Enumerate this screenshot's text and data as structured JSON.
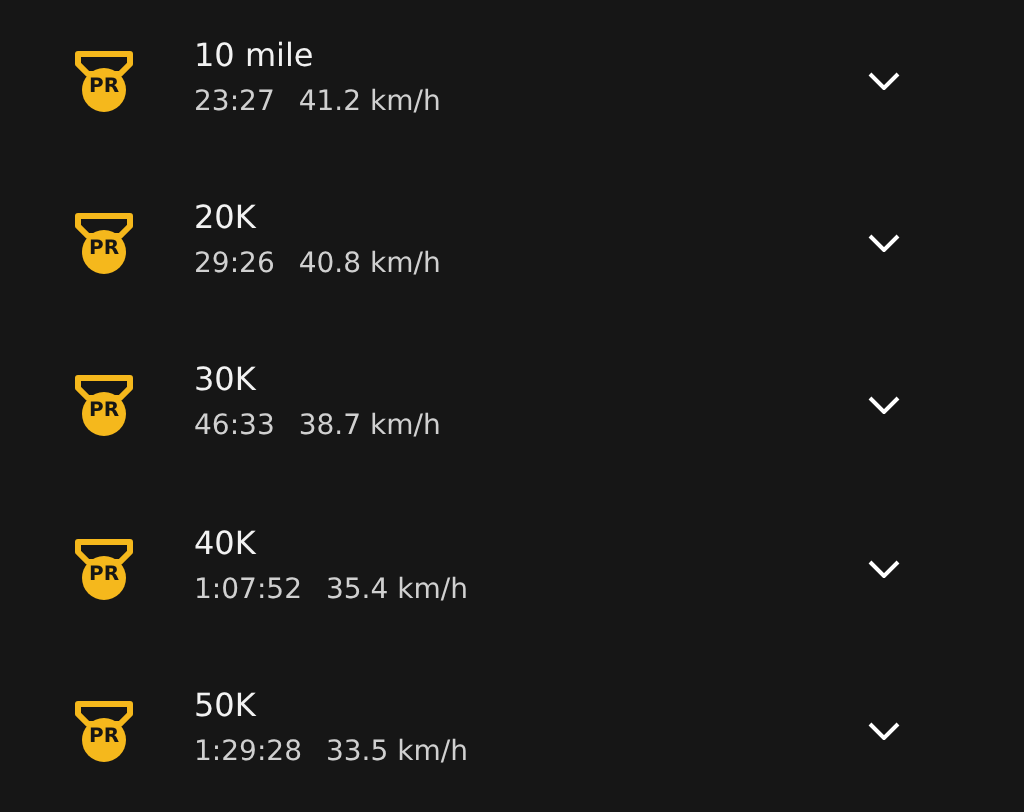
{
  "records": [
    {
      "badge": "PR",
      "title": "10 mile",
      "time": "23:27",
      "speed": "41.2 km/h"
    },
    {
      "badge": "PR",
      "title": "20K",
      "time": "29:26",
      "speed": "40.8 km/h"
    },
    {
      "badge": "PR",
      "title": "30K",
      "time": "46:33",
      "speed": "38.7 km/h"
    },
    {
      "badge": "PR",
      "title": "40K",
      "time": "1:07:52",
      "speed": "35.4 km/h"
    },
    {
      "badge": "PR",
      "title": "50K",
      "time": "1:29:28",
      "speed": "33.5 km/h"
    }
  ]
}
